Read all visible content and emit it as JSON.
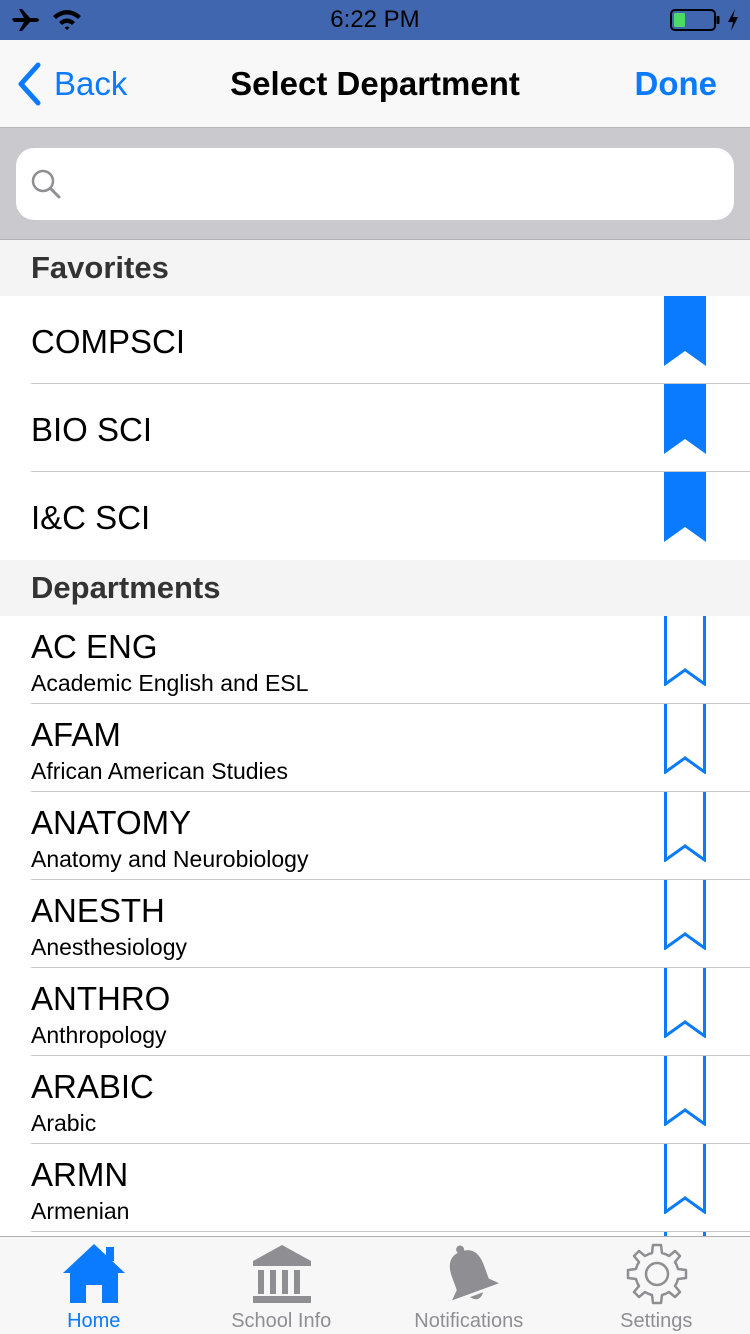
{
  "status_bar": {
    "time": "6:22 PM"
  },
  "nav": {
    "back_label": "Back",
    "title": "Select Department",
    "done_label": "Done"
  },
  "search": {
    "placeholder": "",
    "value": ""
  },
  "sections": {
    "favorites_title": "Favorites",
    "departments_title": "Departments"
  },
  "favorites": [
    {
      "code": "COMPSCI",
      "bookmarked": true
    },
    {
      "code": "BIO SCI",
      "bookmarked": true
    },
    {
      "code": "I&C SCI",
      "bookmarked": true
    }
  ],
  "departments": [
    {
      "code": "AC ENG",
      "name": "Academic English and ESL",
      "bookmarked": false
    },
    {
      "code": "AFAM",
      "name": "African American Studies",
      "bookmarked": false
    },
    {
      "code": "ANATOMY",
      "name": "Anatomy and Neurobiology",
      "bookmarked": false
    },
    {
      "code": "ANESTH",
      "name": "Anesthesiology",
      "bookmarked": false
    },
    {
      "code": "ANTHRO",
      "name": "Anthropology",
      "bookmarked": false
    },
    {
      "code": "ARABIC",
      "name": "Arabic",
      "bookmarked": false
    },
    {
      "code": "ARMN",
      "name": "Armenian",
      "bookmarked": false
    }
  ],
  "tabs": [
    {
      "label": "Home",
      "icon": "home-icon",
      "active": true
    },
    {
      "label": "School Info",
      "icon": "school-icon",
      "active": false
    },
    {
      "label": "Notifications",
      "icon": "bell-icon",
      "active": false
    },
    {
      "label": "Settings",
      "icon": "gear-icon",
      "active": false
    }
  ],
  "colors": {
    "accent": "#0a7aff",
    "status_bar_bg": "#4066b0",
    "tab_inactive": "#8e8e93",
    "battery_fill": "#4cd964"
  }
}
